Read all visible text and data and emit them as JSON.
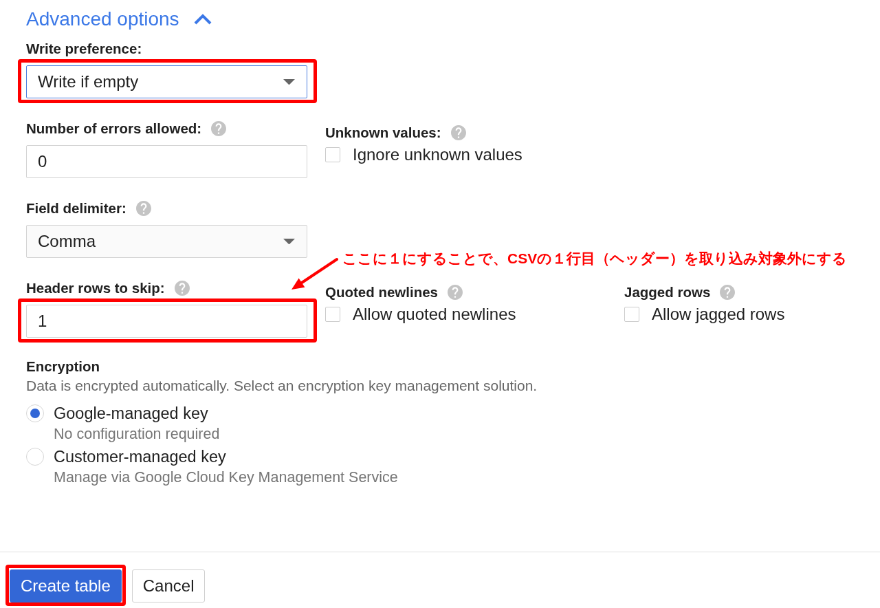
{
  "section": {
    "title": "Advanced options",
    "expanded": true
  },
  "rows": [
    [
      {
        "kind": "select",
        "label": "Write preference:",
        "help": false,
        "value": "Write if empty",
        "focused": true,
        "highlighted": true
      }
    ],
    [
      {
        "kind": "text",
        "label": "Number of errors allowed:",
        "help": true,
        "value": "0",
        "focused": false,
        "highlighted": false
      },
      {
        "kind": "checkbox",
        "label": "Unknown values:",
        "help": true,
        "option": "Ignore unknown values",
        "checked": false,
        "highlighted": false
      }
    ],
    [
      {
        "kind": "select",
        "label": "Field delimiter:",
        "help": true,
        "value": "Comma",
        "focused": false,
        "highlighted": false
      }
    ],
    [
      {
        "kind": "text",
        "label": "Header rows to skip:",
        "help": true,
        "value": "1",
        "focused": false,
        "highlighted": true
      },
      {
        "kind": "checkbox",
        "label": "Quoted newlines",
        "help": true,
        "option": "Allow quoted newlines",
        "checked": false,
        "highlighted": false
      },
      {
        "kind": "checkbox",
        "label": "Jagged rows",
        "help": true,
        "option": "Allow jagged rows",
        "checked": false,
        "highlighted": false
      }
    ]
  ],
  "annotation": {
    "note": "ここに１にすることで、CSVの１行目（ヘッダー）を取り込み対象外にする"
  },
  "encryption": {
    "title": "Encryption",
    "description": "Data is encrypted automatically. Select an encryption key management solution.",
    "options": [
      {
        "label": "Google-managed key",
        "hint": "No configuration required",
        "selected": true
      },
      {
        "label": "Customer-managed key",
        "hint": "Manage via Google Cloud Key Management Service",
        "selected": false
      }
    ]
  },
  "buttons": [
    {
      "kind": "primary",
      "label": "Create table",
      "highlighted": true
    },
    {
      "kind": "secondary",
      "label": "Cancel",
      "highlighted": false
    }
  ]
}
